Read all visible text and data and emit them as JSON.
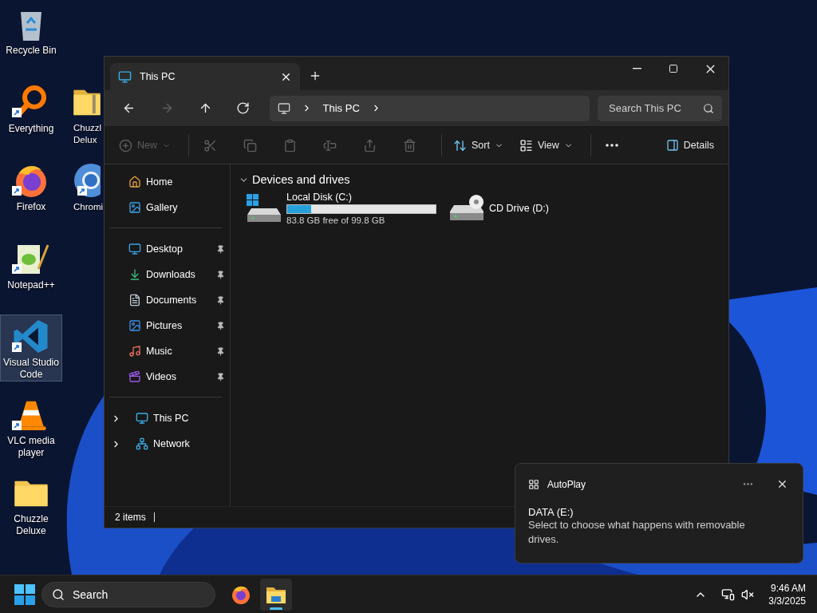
{
  "desktop": {
    "icons": [
      {
        "label": "Recycle Bin",
        "kind": "trash",
        "shortcut": false,
        "selected": false
      },
      {
        "label": "Everything",
        "kind": "loupe",
        "shortcut": true,
        "selected": false
      },
      {
        "label": "Firefox",
        "kind": "firefox",
        "shortcut": true,
        "selected": false
      },
      {
        "label": "Notepad++",
        "kind": "notepad",
        "shortcut": true,
        "selected": false
      },
      {
        "label": "Visual Studio Code",
        "kind": "editor",
        "shortcut": true,
        "selected": true
      },
      {
        "label": "VLC media player",
        "kind": "cone",
        "shortcut": true,
        "selected": false
      },
      {
        "label": "Chuzzle Deluxe",
        "kind": "folder",
        "shortcut": false,
        "selected": false
      }
    ],
    "icons_column_2": [
      {
        "label": "Chuzzl Delux",
        "kind": "zipfolder",
        "shortcut": false,
        "selected": false
      },
      {
        "label": "Chromi",
        "kind": "globe",
        "shortcut": true,
        "selected": false
      }
    ]
  },
  "window": {
    "tabs": [
      {
        "label": "This PC",
        "selected": true
      }
    ],
    "nav": [
      {
        "kind": "back",
        "disabled": false
      },
      {
        "kind": "forward",
        "disabled": true
      },
      {
        "kind": "up",
        "disabled": false
      },
      {
        "kind": "refresh",
        "disabled": false
      }
    ],
    "address": {
      "crumbs": [
        "This PC"
      ]
    },
    "search": {
      "placeholder": "Search This PC"
    },
    "toolbar": [
      [
        {
          "kind": "new",
          "label": "New",
          "disabled": true
        }
      ],
      [
        {
          "kind": "cut",
          "disabled": true
        },
        {
          "kind": "copy",
          "disabled": true
        },
        {
          "kind": "paste",
          "disabled": true
        },
        {
          "kind": "rename",
          "disabled": true
        },
        {
          "kind": "share",
          "disabled": true
        },
        {
          "kind": "delete",
          "disabled": true
        }
      ],
      [
        {
          "kind": "sort",
          "label": "Sort",
          "disabled": false
        },
        {
          "kind": "view",
          "label": "View",
          "disabled": false
        }
      ],
      [
        {
          "kind": "more",
          "disabled": false
        }
      ]
    ],
    "details_button": "Details",
    "sidebar": [
      [
        {
          "label": "Home",
          "kind": "home",
          "pinned": false
        },
        {
          "label": "Gallery",
          "kind": "gallery",
          "pinned": false
        }
      ],
      [
        {
          "label": "Desktop",
          "kind": "desktop",
          "pinned": true
        },
        {
          "label": "Downloads",
          "kind": "downloads",
          "pinned": true
        },
        {
          "label": "Documents",
          "kind": "documents",
          "pinned": true
        },
        {
          "label": "Pictures",
          "kind": "pictures",
          "pinned": true
        },
        {
          "label": "Music",
          "kind": "music",
          "pinned": true
        },
        {
          "label": "Videos",
          "kind": "videos",
          "pinned": true
        }
      ],
      [
        {
          "label": "This PC",
          "kind": "pc",
          "expanded": false
        },
        {
          "label": "Network",
          "kind": "network",
          "expanded": false
        }
      ]
    ],
    "section": {
      "title": "Devices and drives",
      "expanded": true
    },
    "drives": [
      {
        "label": "Local Disk (C:)",
        "kind": "disk",
        "level": 0.16,
        "detail": "83.8 GB free of 99.8 GB"
      },
      {
        "label": "CD Drive (D:)",
        "kind": "cd"
      }
    ],
    "status_bar": "2 items"
  },
  "notification": {
    "app": "AutoPlay",
    "title": "DATA (E:)",
    "message": "Select to choose what happens with removable drives."
  },
  "taskbar": {
    "search": "Search",
    "apps": [
      {
        "kind": "firefox",
        "active": false
      },
      {
        "kind": "explorer",
        "active": true
      }
    ],
    "time": "9:46 AM",
    "date": "3/3/2025"
  }
}
